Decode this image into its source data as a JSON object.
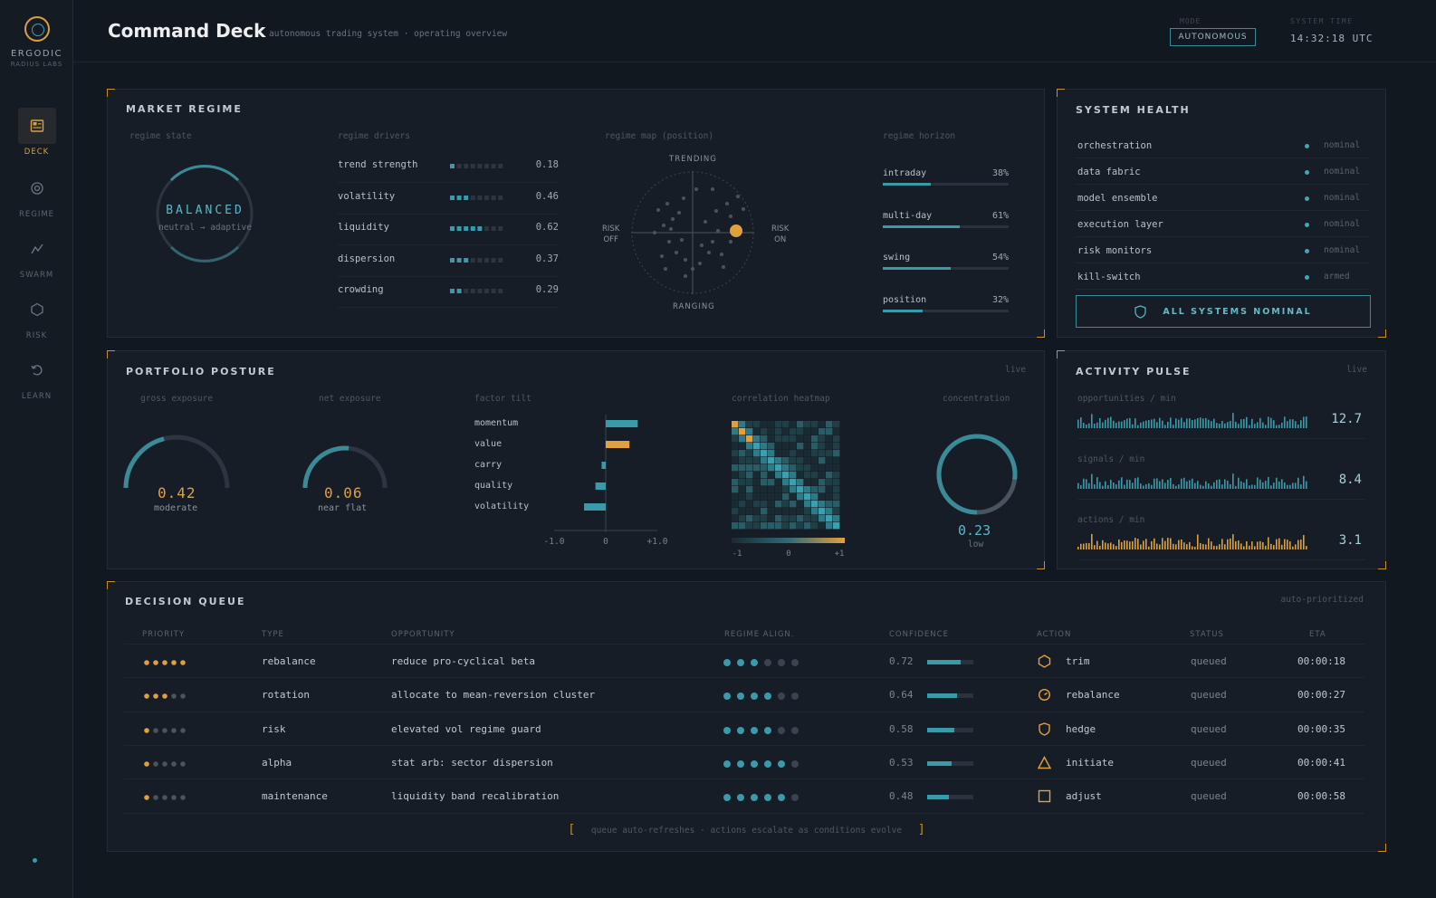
{
  "brand": {
    "name": "ERGODIC",
    "sub": "RADIUS LABS"
  },
  "nav": [
    {
      "label": "DECK",
      "icon": "deck-icon",
      "active": true
    },
    {
      "label": "REGIME",
      "icon": "regime-icon"
    },
    {
      "label": "SWARM",
      "icon": "swarm-icon"
    },
    {
      "label": "RISK",
      "icon": "risk-icon"
    },
    {
      "label": "LEARN",
      "icon": "learn-icon"
    }
  ],
  "header": {
    "title": "Command Deck",
    "subtitle": "autonomous trading system · operating overview",
    "mode_label": "MODE",
    "mode_value": "AUTONOMOUS",
    "time_label": "SYSTEM TIME",
    "time_value": "14:32:18 UTC"
  },
  "colors": {
    "accent": "#3a9aaa",
    "warm": "#e0a040",
    "bg": "#121820",
    "panel": "#171d26"
  },
  "regime": {
    "title": "MARKET REGIME",
    "state_label": "regime state",
    "state_value": "BALANCED",
    "state_sub": "neutral → adaptive",
    "drivers_label": "regime drivers",
    "drivers": [
      {
        "name": "trend strength",
        "value": "0.18",
        "level": 1
      },
      {
        "name": "volatility",
        "value": "0.46",
        "level": 3
      },
      {
        "name": "liquidity",
        "value": "0.62",
        "level": 5
      },
      {
        "name": "dispersion",
        "value": "0.37",
        "level": 3
      },
      {
        "name": "crowding",
        "value": "0.29",
        "level": 2
      }
    ],
    "map_label": "regime map (position)",
    "map_top": "TRENDING",
    "map_bottom": "RANGING",
    "map_left": "RISK\nOFF",
    "map_right": "RISK\nON",
    "horizon_label": "regime horizon",
    "horizon": [
      {
        "name": "intraday",
        "pct": "38%",
        "value": 0.38
      },
      {
        "name": "multi-day",
        "pct": "61%",
        "value": 0.61
      },
      {
        "name": "swing",
        "pct": "54%",
        "value": 0.54
      },
      {
        "name": "position",
        "pct": "32%",
        "value": 0.32
      }
    ]
  },
  "health": {
    "title": "SYSTEM HEALTH",
    "items": [
      {
        "name": "orchestration",
        "status": "nominal"
      },
      {
        "name": "data fabric",
        "status": "nominal"
      },
      {
        "name": "model ensemble",
        "status": "nominal"
      },
      {
        "name": "execution layer",
        "status": "nominal"
      },
      {
        "name": "risk monitors",
        "status": "nominal"
      },
      {
        "name": "kill-switch",
        "status": "armed"
      }
    ],
    "button": "ALL SYSTEMS NOMINAL"
  },
  "posture": {
    "title": "PORTFOLIO POSTURE",
    "live": "live",
    "gross_label": "gross exposure",
    "gross_value": "0.42",
    "gross_sub": "moderate",
    "gross_level": 0.42,
    "net_label": "net exposure",
    "net_value": "0.06",
    "net_sub": "near flat",
    "net_level": 0.53,
    "factor_label": "factor tilt",
    "factors": [
      {
        "name": "momentum",
        "value": 0.62
      },
      {
        "name": "value",
        "value": 0.46
      },
      {
        "name": "carry",
        "value": -0.08
      },
      {
        "name": "quality",
        "value": -0.2
      },
      {
        "name": "volatility",
        "value": -0.42
      }
    ],
    "factor_ticks": [
      "-1.0",
      "0",
      "+1.0"
    ],
    "heatmap_label": "correlation heatmap",
    "heatmap_ticks": [
      "-1",
      "0",
      "+1"
    ],
    "concentration_label": "concentration",
    "concentration_value": "0.23",
    "concentration_sub": "low",
    "concentration_level": 0.77
  },
  "pulse": {
    "title": "ACTIVITY PULSE",
    "live": "live",
    "rows": [
      {
        "label": "opportunities / min",
        "value": "12.7",
        "color": "#3a9aaa"
      },
      {
        "label": "signals / min",
        "value": "8.4",
        "color": "#3a9aaa"
      },
      {
        "label": "actions / min",
        "value": "3.1",
        "color": "#d8a040"
      }
    ]
  },
  "queue": {
    "title": "DECISION QUEUE",
    "note": "auto-prioritized",
    "headers": [
      "PRIORITY",
      "TYPE",
      "OPPORTUNITY",
      "REGIME ALIGN.",
      "CONFIDENCE",
      "ACTION",
      "STATUS",
      "ETA"
    ],
    "rows": [
      {
        "priority": 5,
        "type": "rebalance",
        "opportunity": "reduce pro-cyclical beta",
        "align": 3,
        "confidence": "0.72",
        "conf": 0.72,
        "action": "trim",
        "icon": "hexagon-icon",
        "status": "queued",
        "eta": "00:00:18"
      },
      {
        "priority": 3,
        "type": "rotation",
        "opportunity": "allocate to mean-reversion cluster",
        "align": 4,
        "confidence": "0.64",
        "conf": 0.64,
        "action": "rebalance",
        "icon": "rotate-icon",
        "status": "queued",
        "eta": "00:00:27"
      },
      {
        "priority": 1,
        "type": "risk",
        "opportunity": "elevated vol regime guard",
        "align": 4,
        "confidence": "0.58",
        "conf": 0.58,
        "action": "hedge",
        "icon": "shield-icon",
        "status": "queued",
        "eta": "00:00:35"
      },
      {
        "priority": 1,
        "type": "alpha",
        "opportunity": "stat arb: sector dispersion",
        "align": 5,
        "confidence": "0.53",
        "conf": 0.53,
        "action": "initiate",
        "icon": "triangle-icon",
        "status": "queued",
        "eta": "00:00:41"
      },
      {
        "priority": 1,
        "type": "maintenance",
        "opportunity": "liquidity band recalibration",
        "align": 5,
        "confidence": "0.48",
        "conf": 0.48,
        "action": "adjust",
        "icon": "square-icon",
        "status": "queued",
        "eta": "00:00:58"
      }
    ],
    "footer": "queue auto-refreshes · actions escalate as conditions evolve"
  }
}
